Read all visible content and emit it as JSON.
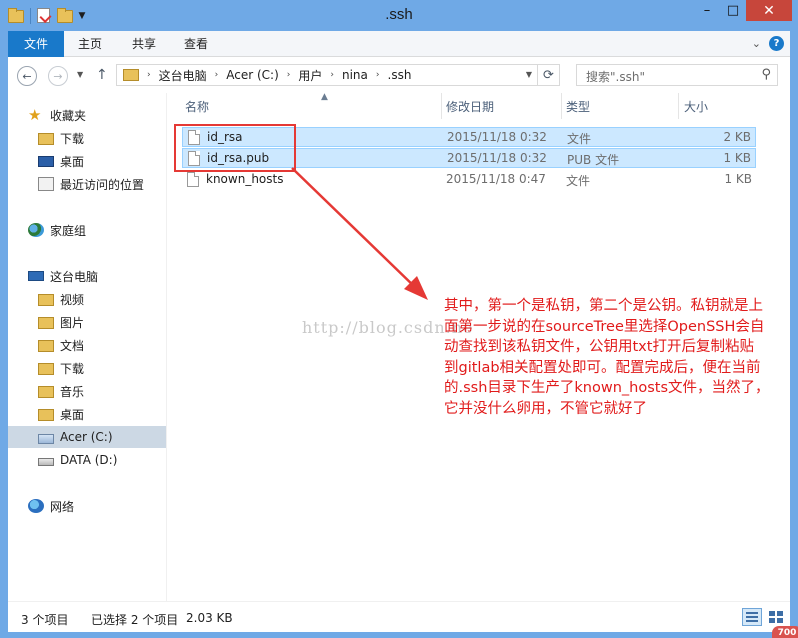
{
  "window": {
    "title": ".ssh"
  },
  "ribbon": {
    "tabs": [
      "文件",
      "主页",
      "共享",
      "查看"
    ]
  },
  "address": {
    "crumbs": [
      "这台电脑",
      "Acer (C:)",
      "用户",
      "nina",
      ".ssh"
    ],
    "search_placeholder": "搜索\".ssh\""
  },
  "nav": {
    "favorites": "收藏夹",
    "fav_items": [
      "下载",
      "桌面",
      "最近访问的位置"
    ],
    "homegroup": "家庭组",
    "this_pc": "这台电脑",
    "pc_items": [
      "视频",
      "图片",
      "文档",
      "下载",
      "音乐",
      "桌面",
      "Acer (C:)",
      "DATA (D:)"
    ],
    "network": "网络"
  },
  "columns": {
    "name": "名称",
    "date": "修改日期",
    "type": "类型",
    "size": "大小"
  },
  "files": [
    {
      "name": "id_rsa",
      "date": "2015/11/18 0:32",
      "type": "文件",
      "size": "2 KB",
      "selected": true
    },
    {
      "name": "id_rsa.pub",
      "date": "2015/11/18 0:32",
      "type": "PUB 文件",
      "size": "1 KB",
      "selected": true
    },
    {
      "name": "known_hosts",
      "date": "2015/11/18 0:47",
      "type": "文件",
      "size": "1 KB",
      "selected": false
    }
  ],
  "annotation": {
    "watermark": "http://blog.csdn.ne",
    "lines": [
      "其中，第一个是私钥，第二个是公钥。私钥就是上",
      "面第一步说的在sourceTree里选择OpenSSH会自",
      "动查找到该私钥文件，公钥用txt打开后复制粘贴",
      "到gitlab相关配置处即可。配置完成后，便在当前",
      "的.ssh目录下生产了known_hosts文件，当然了，",
      "它并没什么卵用，不管它就好了"
    ],
    "color": "#e11b1b"
  },
  "status": {
    "count": "3 个项目",
    "selected": "已选择 2 个项目",
    "size": "2.03 KB"
  },
  "badge": "700"
}
